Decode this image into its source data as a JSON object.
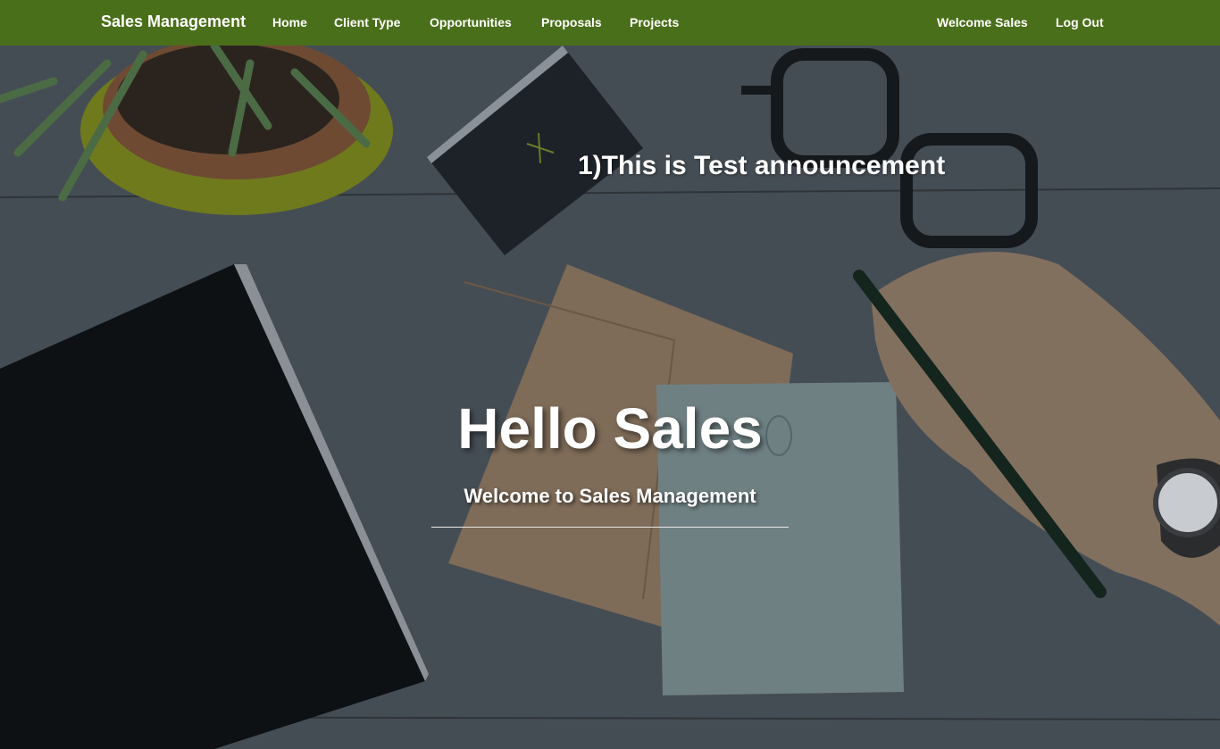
{
  "navbar": {
    "brand": "Sales Management",
    "links": {
      "home": "Home",
      "client_type": "Client Type",
      "opportunities": "Opportunities",
      "proposals": "Proposals",
      "projects": "Projects"
    },
    "user_greeting": "Welcome Sales",
    "logout": "Log Out",
    "color": "#4a6f1a"
  },
  "main": {
    "announcement": "1)This is Test announcement",
    "title": "Hello Sales",
    "subtitle": "Welcome to Sales Management"
  }
}
